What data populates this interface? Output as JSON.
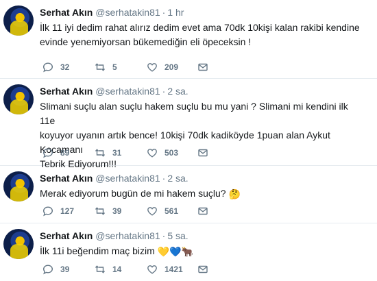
{
  "tweets": [
    {
      "name": "Serhat Akın",
      "handle": "@serhatakin81",
      "separator": "·",
      "time": "1 hr",
      "lines": [
        "İlk 11 iyi dedim rahat alırız dedim evet ama 70dk 10kişi kalan rakibi kendine",
        "evinde yenemiyorsan bükemediğin eli öpeceksin !"
      ],
      "replies": "32",
      "retweets": "5",
      "likes": "209"
    },
    {
      "name": "Serhat Akın",
      "handle": "@serhatakin81",
      "separator": "·",
      "time": "2 sa.",
      "lines": [
        "Slimani suçlu alan suçlu hakem suçlu bu mu yani ? Slimani mi kendini ilk 11e",
        "koyuyor uyanın artık bence! 10kişi 70dk kadiköyde 1puan alan Aykut Kocamanı",
        "Tebrik Ediyorum!!!"
      ],
      "replies": "89",
      "retweets": "31",
      "likes": "503"
    },
    {
      "name": "Serhat Akın",
      "handle": "@serhatakin81",
      "separator": "·",
      "time": "2 sa.",
      "lines": [
        "Merak ediyorum bugün de mi hakem suçlu?"
      ],
      "emoji": "🤔",
      "replies": "127",
      "retweets": "39",
      "likes": "561"
    },
    {
      "name": "Serhat Akın",
      "handle": "@serhatakin81",
      "separator": "·",
      "time": "5 sa.",
      "lines": [
        "İlk 11i beğendim maç bizim"
      ],
      "emoji": "💛💙🐂",
      "replies": "39",
      "retweets": "14",
      "likes": "1421"
    }
  ],
  "icons": {
    "reply": "reply-icon",
    "retweet": "retweet-icon",
    "like": "heart-icon",
    "dm": "envelope-icon",
    "avatar": "avatar"
  },
  "colors": {
    "text": "#14171a",
    "secondary": "#657786",
    "divider": "#e6ecf0"
  }
}
